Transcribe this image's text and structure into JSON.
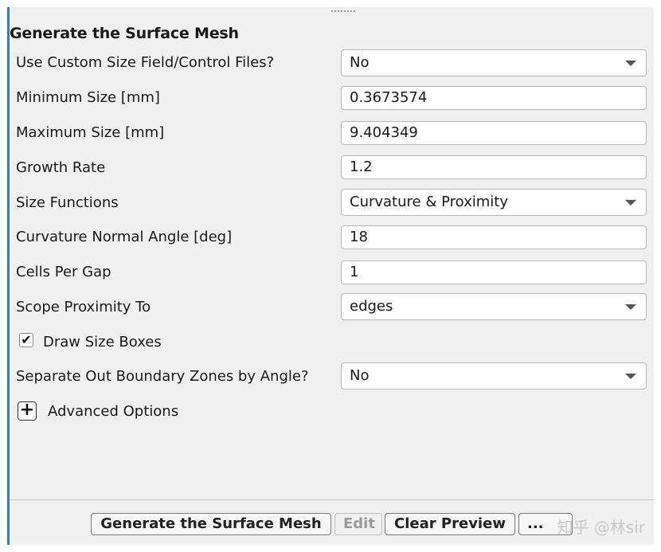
{
  "panel": {
    "title": "Generate the Surface Mesh",
    "rows": [
      {
        "label": "Use Custom Size Field/Control Files?",
        "value": "No",
        "kind": "select"
      },
      {
        "label": "Minimum Size [mm]",
        "value": "0.3673574",
        "kind": "input"
      },
      {
        "label": "Maximum Size [mm]",
        "value": "9.404349",
        "kind": "input"
      },
      {
        "label": "Growth Rate",
        "value": "1.2",
        "kind": "input"
      },
      {
        "label": "Size Functions",
        "value": "Curvature & Proximity",
        "kind": "select"
      },
      {
        "label": "Curvature Normal Angle [deg]",
        "value": "18",
        "kind": "input"
      },
      {
        "label": "Cells Per Gap",
        "value": "1",
        "kind": "input"
      },
      {
        "label": "Scope Proximity To",
        "value": "edges",
        "kind": "select"
      }
    ],
    "draw_size_boxes": {
      "label": "Draw Size Boxes",
      "checked": true,
      "mark": "✔"
    },
    "separate_zones": {
      "label": "Separate Out Boundary Zones by Angle?",
      "value": "No"
    },
    "advanced": {
      "label": "Advanced Options",
      "symbol": "+"
    }
  },
  "buttons": {
    "generate": "Generate the Surface Mesh",
    "edit": "Edit",
    "clear": "Clear Preview",
    "more": "..."
  },
  "watermark": "知乎 @林sir",
  "colors": {
    "accent": "#2f7fc1",
    "background": "#f0f0f0"
  }
}
